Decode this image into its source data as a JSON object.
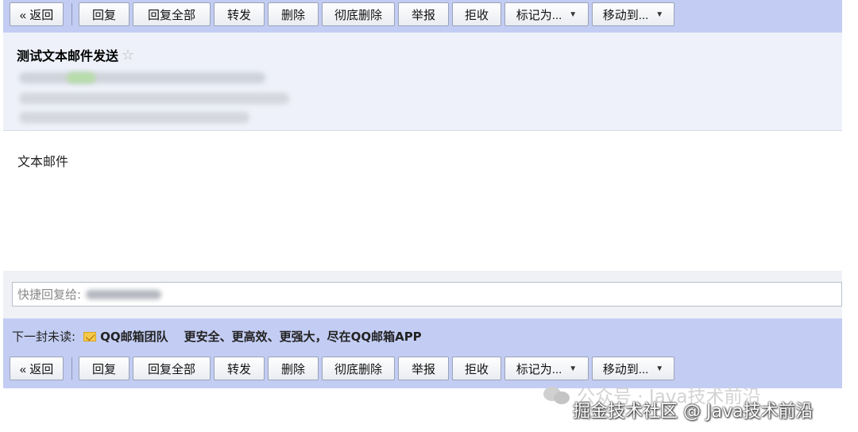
{
  "toolbar": {
    "back": "« 返回",
    "reply": "回复",
    "reply_all": "回复全部",
    "forward": "转发",
    "delete": "删除",
    "permanent_delete": "彻底删除",
    "report": "举报",
    "reject": "拒收",
    "mark_as": "标记为...",
    "move_to": "移动到..."
  },
  "email": {
    "subject": "测试文本邮件发送",
    "star": "☆",
    "body": "文本邮件"
  },
  "quick_reply": {
    "label": "快捷回复给:"
  },
  "next_unread": {
    "label": "下一封未读:",
    "sender": "QQ邮箱团队",
    "subject": "更安全、更高效、更强大，尽在QQ邮箱APP"
  },
  "watermark": {
    "line1": "公众号 · Java技术前沿",
    "line2": "掘金技术社区 @ Java技术前沿"
  },
  "colors": {
    "toolbar_bg": "#c3cdf3",
    "header_bg": "#eef1f9"
  }
}
